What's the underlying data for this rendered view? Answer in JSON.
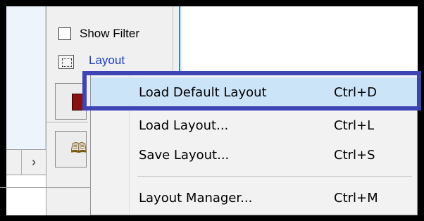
{
  "panel": {
    "show_filter_label": "Show Filter",
    "layout_link": "Layout",
    "scroll_right": "›"
  },
  "context_menu": {
    "items": [
      {
        "label": "Load Default Layout",
        "shortcut": "Ctrl+D",
        "highlighted": true
      },
      {
        "label": "Load Layout...",
        "shortcut": "Ctrl+L"
      },
      {
        "label": "Save Layout...",
        "shortcut": "Ctrl+S"
      },
      {
        "label": "Layout Manager...",
        "shortcut": "Ctrl+M"
      }
    ]
  },
  "colors": {
    "highlight_border": "#3c44b6",
    "menu_hover": "#cce4f7",
    "link": "#1a3ecf"
  },
  "icons": {
    "layout": "layout-icon",
    "tool_1": "red-square-icon",
    "tool_2": "book-icon"
  }
}
